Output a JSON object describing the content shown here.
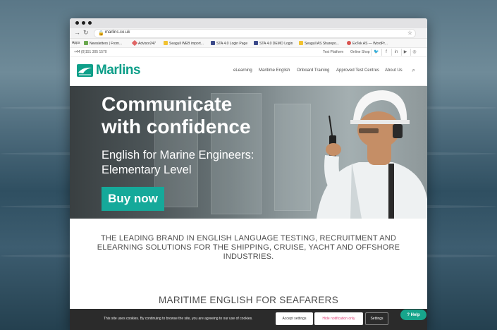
{
  "browser": {
    "url": "marlins.co.uk",
    "bookmarks": [
      {
        "label": "Apps",
        "icon": "apps-grid-icon"
      },
      {
        "label": "Newsletters | From...",
        "icon": "leaf-icon"
      },
      {
        "label": "Advisor247",
        "icon": "bookmark-icon"
      },
      {
        "label": "Seagull WEB import...",
        "icon": "seagull-icon"
      },
      {
        "label": "STA 4.0 Login Page",
        "icon": "page-icon"
      },
      {
        "label": "STA 4.0 DEMO Login",
        "icon": "page-icon"
      },
      {
        "label": "Seagull AS Sharepo...",
        "icon": "seagull-icon"
      },
      {
        "label": "ExTek AS — WordPr...",
        "icon": "wordpress-icon"
      }
    ]
  },
  "topbar": {
    "phone": "+44 (0)151 305 1570",
    "links": [
      "Test Platform",
      "Online Shop"
    ],
    "social": [
      "twitter-icon",
      "facebook-icon",
      "linkedin-icon",
      "youtube-icon",
      "instagram-icon"
    ]
  },
  "header": {
    "logo": "Marlins",
    "nav": [
      "eLearning",
      "Maritime English",
      "Onboard Training",
      "Approved Test Centres",
      "About Us"
    ]
  },
  "hero": {
    "headline_1": "Communicate",
    "headline_2": "with confidence",
    "subtitle_1": "English for Marine Engineers:",
    "subtitle_2": "Elementary Level",
    "cta": "Buy now"
  },
  "tagline": {
    "line1": "THE LEADING BRAND IN ENGLISH LANGUAGE TESTING, RECRUITMENT AND",
    "line2": "ELEARNING SOLUTIONS FOR THE SHIPPING, CRUISE, YACHT AND OFFSHORE",
    "line3": "INDUSTRIES."
  },
  "section_title": "MARITIME ENGLISH FOR SEAFARERS",
  "cookie": {
    "text": "This site uses cookies. By continuing to browse the site, you are agreeing to our use of cookies.",
    "accept": "Accept settings",
    "hide": "Hide notification only",
    "settings": "Settings"
  },
  "help": "Help",
  "colors": {
    "brand": "#0e9f89",
    "cta": "#15a99a",
    "help": "#17a58c",
    "hide_text": "#e0457b"
  }
}
